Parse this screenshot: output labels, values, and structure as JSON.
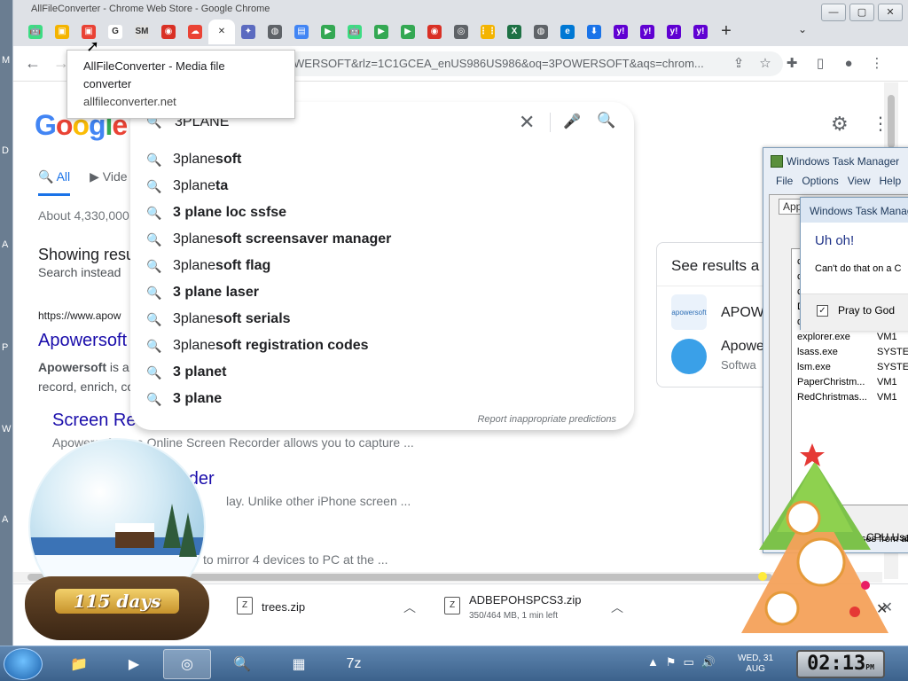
{
  "window": {
    "title": "AllFileConverter - Chrome Web Store - Google Chrome",
    "min": "—",
    "max": "▢",
    "close": "✕"
  },
  "tabs": [
    {
      "icon": "android-icon",
      "glyph": "🤖",
      "color": "#3ddc84"
    },
    {
      "icon": "folder-icon",
      "glyph": "▣",
      "color": "#f4b400"
    },
    {
      "icon": "allfileconverter-icon",
      "glyph": "▣",
      "color": "#e94235"
    },
    {
      "icon": "google-icon",
      "glyph": "G",
      "color": "#ffffff"
    },
    {
      "icon": "sm-icon",
      "glyph": "SM",
      "color": "#e0e0e0"
    },
    {
      "icon": "record-icon",
      "glyph": "◉",
      "color": "#d93025"
    },
    {
      "icon": "cloud-icon",
      "glyph": "☁",
      "color": "#ea4335"
    },
    {
      "icon": "close-tab-icon",
      "glyph": "✕",
      "color": "#ffffff"
    },
    {
      "icon": "app-icon",
      "glyph": "✦",
      "color": "#5c6bc0"
    },
    {
      "icon": "globe-icon",
      "glyph": "◍",
      "color": "#5f6368"
    },
    {
      "icon": "layout-icon",
      "glyph": "▤",
      "color": "#4285f4"
    },
    {
      "icon": "play-store-icon",
      "glyph": "▶",
      "color": "#34a853"
    },
    {
      "icon": "android-icon",
      "glyph": "🤖",
      "color": "#3ddc84"
    },
    {
      "icon": "play-store-icon",
      "glyph": "▶",
      "color": "#34a853"
    },
    {
      "icon": "play-store-icon",
      "glyph": "▶",
      "color": "#34a853"
    },
    {
      "icon": "record-icon",
      "glyph": "◉",
      "color": "#d93025"
    },
    {
      "icon": "chrome-icon",
      "glyph": "◎",
      "color": "#5f6368"
    },
    {
      "icon": "grid-icon",
      "glyph": "⋮⋮",
      "color": "#f4b400"
    },
    {
      "icon": "excel-icon",
      "glyph": "X",
      "color": "#1e7145"
    },
    {
      "icon": "globe-icon",
      "glyph": "◍",
      "color": "#5f6368"
    },
    {
      "icon": "edge-icon",
      "glyph": "e",
      "color": "#0078d4"
    },
    {
      "icon": "download-icon",
      "glyph": "⬇",
      "color": "#1a73e8"
    },
    {
      "icon": "yahoo-icon",
      "glyph": "y!",
      "color": "#6001d2"
    },
    {
      "icon": "yahoo-icon",
      "glyph": "y!",
      "color": "#6001d2"
    },
    {
      "icon": "yahoo-icon",
      "glyph": "y!",
      "color": "#6001d2"
    },
    {
      "icon": "yahoo-icon",
      "glyph": "y!",
      "color": "#6001d2"
    }
  ],
  "toolbar": {
    "back": "←",
    "forward": "→",
    "url": "WERSOFT&rlz=1C1GCEA_enUS986US986&oq=3POWERSOFT&aqs=chrom...",
    "share": "⇪",
    "star": "☆",
    "extensions": "✚",
    "sidepanel": "▯",
    "profile": "●",
    "menu": "⋮",
    "newtab": "+",
    "tabsearch": "⌄"
  },
  "tooltip": {
    "title_line1": "AllFileConverter - Media file",
    "title_line2": "converter",
    "domain": "allfileconverter.net"
  },
  "search": {
    "logo": [
      "G",
      "o",
      "o",
      "g",
      "l",
      "e"
    ],
    "query": "3PLANE",
    "lead_icon": "🔍",
    "clear": "✕",
    "mic": "🎤",
    "go": "🔍",
    "suggestions": [
      {
        "pre": "3plane",
        "bold": "soft"
      },
      {
        "pre": "3plane",
        "bold": "ta"
      },
      {
        "pre": "",
        "bold": "3 plane loc ssfse"
      },
      {
        "pre": "3plane",
        "bold": "soft screensaver manager"
      },
      {
        "pre": "3plane",
        "bold": "soft flag"
      },
      {
        "pre": "",
        "bold": "3 plane laser"
      },
      {
        "pre": "3plane",
        "bold": "soft serials"
      },
      {
        "pre": "3plane",
        "bold": "soft registration codes"
      },
      {
        "pre": "",
        "bold": "3 planet"
      },
      {
        "pre": "",
        "bold": "3 plane"
      }
    ],
    "report": "Report inappropriate predictions"
  },
  "serp": {
    "tab_all": "All",
    "tab_videos": "Vide",
    "about": "About 4,330,000",
    "showing": "Showing resu",
    "instead": "Search instead",
    "result_url": "https://www.apow",
    "result_title": "Apowersoft",
    "snippet_bold": "Apowersoft",
    "snippet_rest": " is a",
    "snippet_line2": "record, enrich, co",
    "sub1_title": "Screen Re",
    "sub1_snip": "Apowersoft Free Online Screen Recorder allows you to capture ...",
    "sub2_title": "order",
    "sub2_snip": "lay. Unlike other iPhone screen ...",
    "sub3_snip": "to mirror 4 devices to PC at the ..."
  },
  "knowledge": {
    "title": "See results a",
    "item1_logo": "apowersoft",
    "item1_name": "APOW",
    "item2_name": "Apowe",
    "item2_sub": "Softwa"
  },
  "header_icons": {
    "settings": "⚙",
    "apps": "⋮"
  },
  "downloads": [
    {
      "name": "trees.zip",
      "meta": "",
      "icon": "Z"
    },
    {
      "name": "ADBEPOHSPCS3.zip",
      "meta": "350/464 MB, 1 min left",
      "icon": "Z"
    }
  ],
  "shelf": {
    "chevron": "︿",
    "close": "✕"
  },
  "taskmgr": {
    "title": "Windows Task Manager",
    "menu": [
      "File",
      "Options",
      "View",
      "Help"
    ],
    "tab": "Appl",
    "processes": [
      {
        "name": "chrome.exe",
        "user": "VM1"
      },
      {
        "name": "csrss.exe",
        "user": "SYSTEM"
      },
      {
        "name": "csrss.exe",
        "user": "SYSTEM"
      },
      {
        "name": "DriverUpdater...",
        "user": "VM1"
      },
      {
        "name": "dwm.exe",
        "user": "VM1"
      },
      {
        "name": "explorer.exe",
        "user": "VM1"
      },
      {
        "name": "lsass.exe",
        "user": "SYSTEM"
      },
      {
        "name": "lsm.exe",
        "user": "SYSTEM"
      },
      {
        "name": "PaperChristm...",
        "user": "VM1"
      },
      {
        "name": "RedChristmas...",
        "user": "VM1"
      }
    ],
    "footer": "processes from all",
    "cpu": "CPU Usag"
  },
  "dialog": {
    "title": "Windows Task Manag",
    "heading": "Uh oh!",
    "message": "Can't do that on a C",
    "checkbox_label": "Pray to God",
    "checked": "✓"
  },
  "globe": {
    "label": "115 days"
  },
  "taskbar": {
    "apps": [
      {
        "name": "explorer",
        "glyph": "📁"
      },
      {
        "name": "media-player",
        "glyph": "▶"
      },
      {
        "name": "chrome",
        "glyph": "◎"
      },
      {
        "name": "search-tool",
        "glyph": "🔍"
      },
      {
        "name": "task-manager",
        "glyph": "▦"
      },
      {
        "name": "7zip",
        "glyph": "7z"
      }
    ],
    "tray": [
      "▲",
      "⚑",
      "▭",
      "🔊"
    ],
    "date_line1": "WED, 31",
    "date_line2": "AUG",
    "time": "02:13",
    "ampm": "PM"
  }
}
